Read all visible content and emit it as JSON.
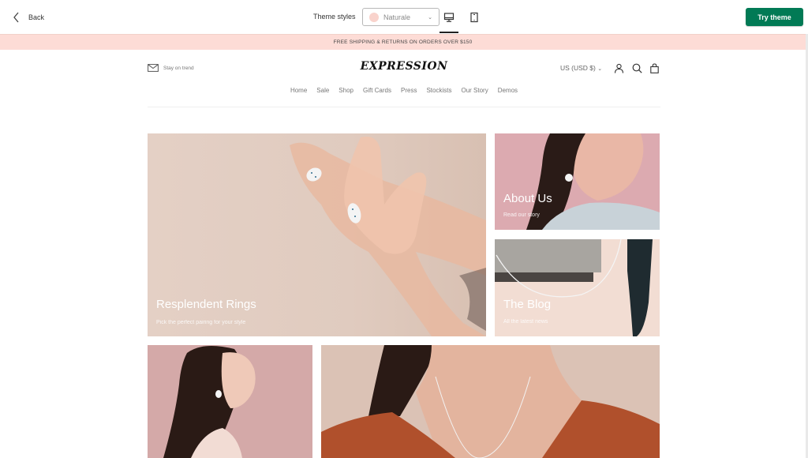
{
  "topbar": {
    "back_label": "Back",
    "theme_styles_label": "Theme styles",
    "selected_style": "Naturale",
    "selected_style_swatch": "#f9d3cc",
    "devices": [
      "desktop",
      "mobile"
    ],
    "active_device": "desktop",
    "try_theme_label": "Try theme",
    "try_theme_color": "#017a55"
  },
  "announcement": {
    "text": "FREE SHIPPING & RETURNS ON ORDERS OVER $150",
    "background": "#fddcd6"
  },
  "store": {
    "newsletter_label": "Stay on trend",
    "logo": "EXPRESSION",
    "currency": "US (USD $)",
    "header_icons": [
      "account-icon",
      "search-icon",
      "cart-icon"
    ],
    "nav": [
      "Home",
      "Sale",
      "Shop",
      "Gift Cards",
      "Press",
      "Stockists",
      "Our Story",
      "Demos"
    ]
  },
  "tiles": [
    {
      "title": "Resplendent Rings",
      "subtitle": "Pick the perfect pairing for your style"
    },
    {
      "title": "About Us",
      "subtitle": "Read our story"
    },
    {
      "title": "The Blog",
      "subtitle": "All the latest news"
    },
    {
      "title": "",
      "subtitle": ""
    },
    {
      "title": "",
      "subtitle": ""
    }
  ]
}
